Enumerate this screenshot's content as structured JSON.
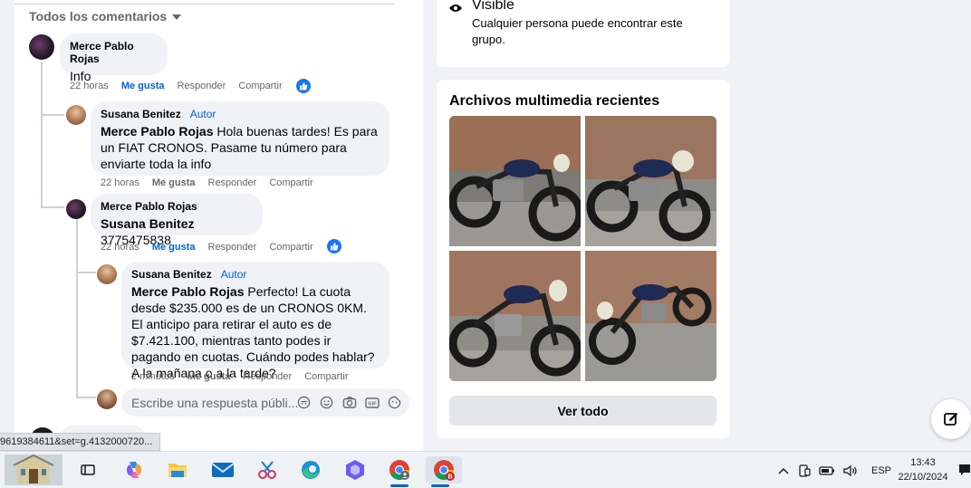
{
  "comments": {
    "sort_label": "Todos los comentarios",
    "items": [
      {
        "author": "Merce Pablo Rojas",
        "mention": "",
        "text": "Info",
        "time": "22 horas",
        "like": "Me gusta",
        "reply": "Responder",
        "share": "Compartir"
      },
      {
        "author": "Susana Benitez",
        "badge": "Autor",
        "mention": "Merce Pablo Rojas",
        "text": " Hola buenas tardes! Es para un FIAT CRONOS. Pasame tu número para enviarte toda la info",
        "time": "22 horas",
        "like": "Me gusta",
        "reply": "Responder",
        "share": "Compartir"
      },
      {
        "author": "Merce Pablo Rojas",
        "mention": "Susana Benitez",
        "text": " 3775475838",
        "time": "22 horas",
        "like": "Me gusta",
        "reply": "Responder",
        "share": "Compartir"
      },
      {
        "author": "Susana Benitez",
        "badge": "Autor",
        "mention": "Merce Pablo Rojas",
        "text": " Perfecto! La cuota desde $235.000 es de un CRONOS 0KM. El anticipo para retirar el auto es de $7.421.100, mientras tanto podes ir pagando en cuotas. Cuándo podes hablar? A la mañana o a la tarde?",
        "time": "2 minutos",
        "like": "Me gusta",
        "reply": "Responder",
        "share": "Compartir"
      }
    ],
    "reply_placeholder": "Escribe una respuesta públi..."
  },
  "privacy": {
    "title": "Visible",
    "description": "Cualquier persona puede encontrar este grupo."
  },
  "media": {
    "title": "Archivos multimedia recientes",
    "see_all": "Ver todo"
  },
  "status_url": "9619384611&set=g.4132000720...",
  "taskbar": {
    "language": "ESP",
    "time": "13:43",
    "date": "22/10/2024"
  },
  "colors": {
    "link_blue": "#0064d1",
    "like_blue": "#1877f2",
    "bubble_bg": "#f0f2f5"
  }
}
